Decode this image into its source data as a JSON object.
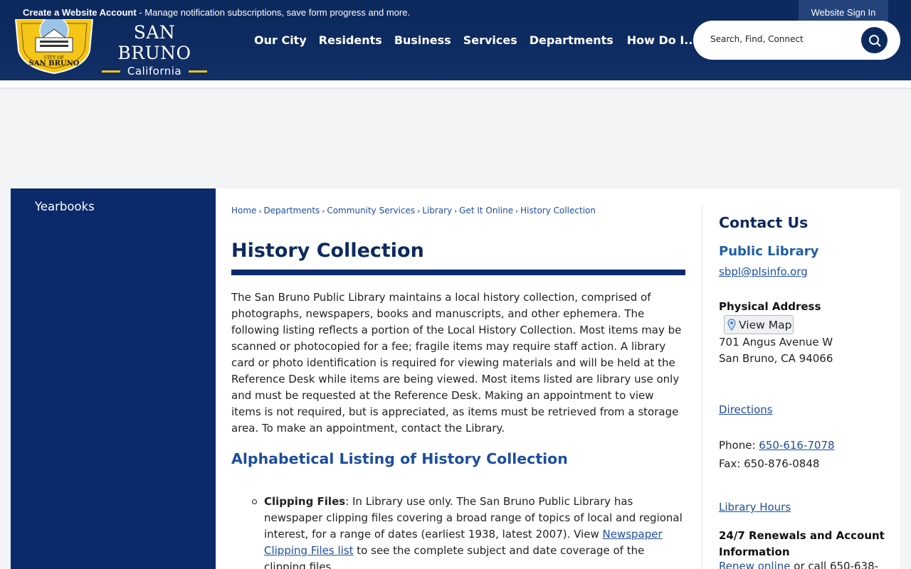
{
  "topbar": {
    "create_account": "Create a Website Account",
    "message": " - Manage notification subscriptions, save form progress and more.",
    "sign_in": "Website Sign In"
  },
  "logo": {
    "city": "SAN BRUNO",
    "state": "California",
    "seal_top": "CITY OF",
    "seal_bottom": "SAN BRUNO"
  },
  "nav": {
    "items": [
      "Our City",
      "Residents",
      "Business",
      "Services",
      "Departments",
      "How Do I..."
    ]
  },
  "search": {
    "placeholder": "Search, Find, Connect"
  },
  "sidebar": {
    "items": [
      "Yearbooks"
    ]
  },
  "breadcrumb": [
    "Home",
    "Departments",
    "Community Services",
    "Library",
    "Get It Online",
    "History Collection"
  ],
  "page": {
    "title": "History Collection",
    "intro": "The San Bruno Public Library maintains a local history collection, comprised of photographs, newspapers, books and manuscripts, and other ephemera. The following listing reflects a portion of the Local History Collection. Most items may be scanned or photocopied for a fee; fragile items may require staff action. A library card or photo identification is required for viewing materials and will be held at the Reference Desk while items are being viewed. Most items listed are library use only and must be requested at the Reference Desk. Making an appointment to view items is not required, but is appreciated, as items must be retrieved from a storage area. To make an appointment, contact the Library.",
    "subheading": "Alphabetical Listing of History Collection",
    "list": [
      {
        "title": "Clipping Files",
        "text_before": ": In Library use only. The San Bruno Public Library has newspaper clipping files covering a broad range of topics of local and regional interest, for a range of dates (earliest 1938, latest 2007). View ",
        "link": "Newspaper Clipping Files list",
        "text_after": " to see the complete subject and date coverage of the clipping files."
      }
    ]
  },
  "contact": {
    "heading": "Contact Us",
    "department": "Public Library",
    "email": "sbpl@plsinfo.org",
    "address_label": "Physical Address",
    "view_map": "View Map",
    "street": "701 Angus Avenue W",
    "city_line": "San Bruno, CA 94066",
    "directions": "Directions",
    "phone_label": "Phone: ",
    "phone": "650-616-7078",
    "fax": "Fax: 650-876-0848",
    "hours": "Library Hours",
    "renewals_label": "24/7 Renewals and Account Information",
    "renew_link": "Renew online",
    "renew_text": " or call 650-638-"
  },
  "colors": {
    "navy": "#0d2a5f",
    "sidebar": "#0a2a6b",
    "link": "#1d4e9e",
    "gold": "#f0c419"
  }
}
